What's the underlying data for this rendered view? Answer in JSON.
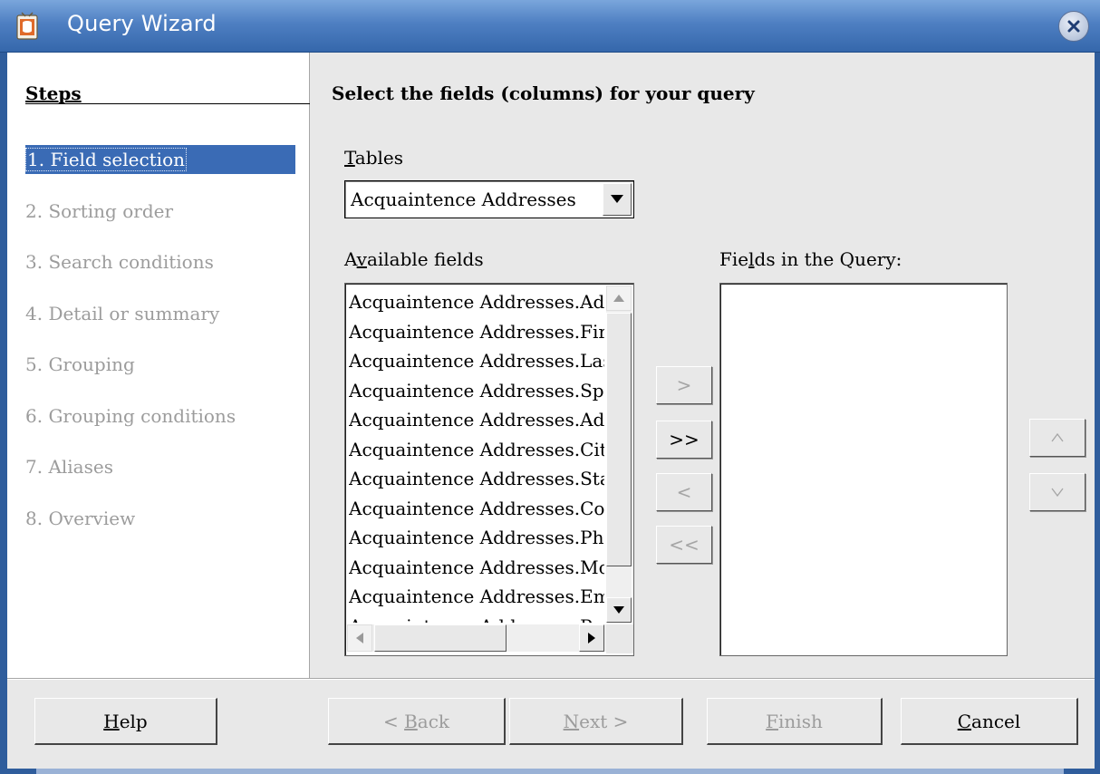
{
  "window": {
    "title": "Query Wizard"
  },
  "steps": {
    "heading": "Steps",
    "items": [
      {
        "label": "1. Field selection",
        "state": "active"
      },
      {
        "label": "2. Sorting order",
        "state": "disabled"
      },
      {
        "label": "3. Search conditions",
        "state": "disabled"
      },
      {
        "label": "4. Detail or summary",
        "state": "disabled"
      },
      {
        "label": "5. Grouping",
        "state": "disabled"
      },
      {
        "label": "6. Grouping conditions",
        "state": "disabled"
      },
      {
        "label": "7. Aliases",
        "state": "disabled"
      },
      {
        "label": "8. Overview",
        "state": "disabled"
      }
    ]
  },
  "main": {
    "heading": "Select the fields (columns) for your query",
    "tables_label_accel": "T",
    "tables_label_rest": "ables",
    "tables_selected": "Acquaintence Addresses",
    "available_label_pre": "A",
    "available_label_accel": "v",
    "available_label_rest": "ailable fields",
    "available_fields": [
      "Acquaintence Addresses.Add",
      "Acquaintence Addresses.Firs",
      "Acquaintence Addresses.Last",
      "Acquaintence Addresses.Spo",
      "Acquaintence Addresses.Adc",
      "Acquaintence Addresses.City",
      "Acquaintence Addresses.Stat",
      "Acquaintence Addresses.Cou",
      "Acquaintence Addresses.Pho",
      "Acquaintence Addresses.Mob",
      "Acquaintence Addresses.Ema",
      "Acquaintence Addresses.Pos"
    ],
    "query_label_pre": "Fie",
    "query_label_accel": "l",
    "query_label_rest": "ds in the Query:",
    "move_buttons": {
      "add_one": ">",
      "add_all": ">>",
      "remove_one": "<",
      "remove_all": "<<"
    },
    "order_buttons": {
      "up": "^",
      "down": "v"
    }
  },
  "footer": {
    "help_accel": "H",
    "help_rest": "elp",
    "back_pre": "< ",
    "back_accel": "B",
    "back_rest": "ack",
    "next_accel": "N",
    "next_rest": "ext >",
    "finish_accel": "F",
    "finish_rest": "inish",
    "cancel_accel": "C",
    "cancel_rest": "ancel"
  },
  "colors": {
    "titlebar": "#4e7fc2",
    "selection": "#3a6bb5",
    "dialog_bg": "#e8e8e8",
    "disabled_text": "#9c9c9c"
  }
}
